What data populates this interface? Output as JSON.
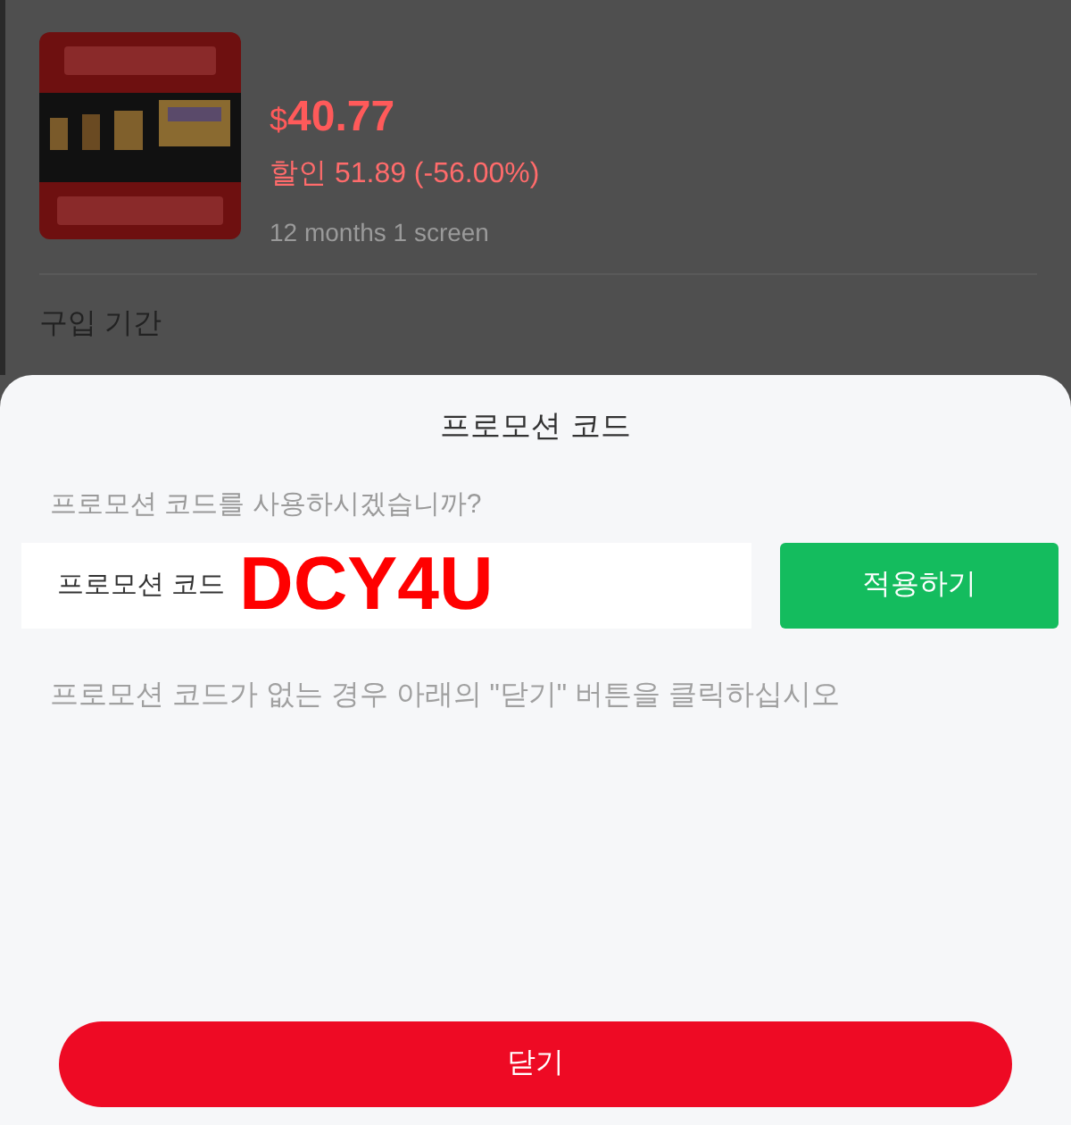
{
  "product": {
    "currency": "$",
    "price": "40.77",
    "discount": "할인 51.89 (-56.00%)",
    "plan": "12 months 1 screen"
  },
  "section_title": "구입 기간",
  "sheet": {
    "title": "프로모션 코드",
    "question": "프로모션 코드를 사용하시겠습니까?",
    "field": {
      "placeholder": "프로모션 코드"
    },
    "apply_button": "적용하기",
    "hint": "프로모션 코드가 없는 경우 아래의 \"닫기\" 버튼을 클릭하십시오",
    "close_button": "닫기"
  },
  "annotation": "DCY4U"
}
